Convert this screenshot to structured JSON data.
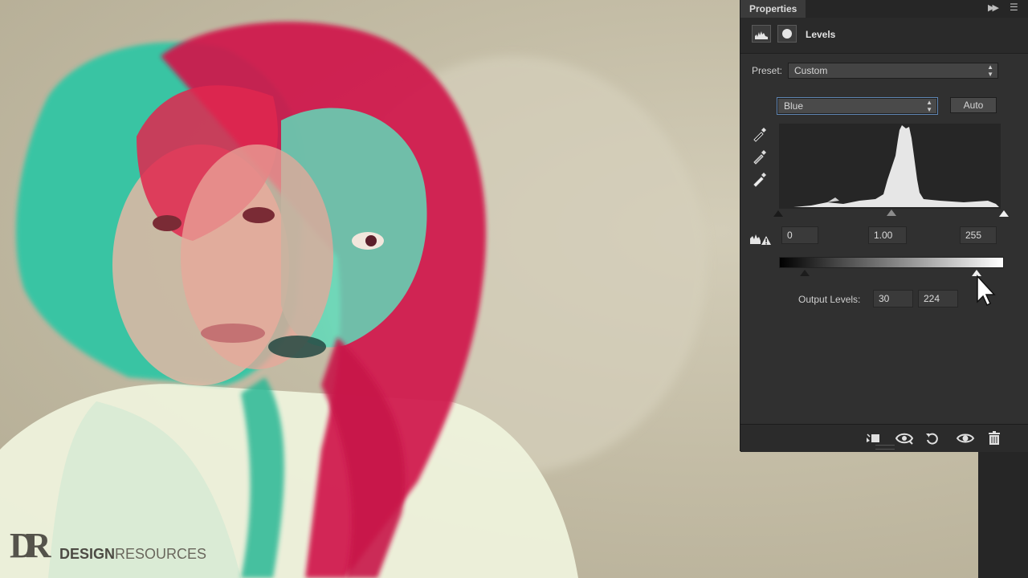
{
  "watermark": {
    "logo": "DR",
    "brand_bold": "DESIGN",
    "brand_light": "RESOURCES"
  },
  "panel": {
    "tab_label": "Properties",
    "layer_title": "Levels",
    "preset_label": "Preset:",
    "preset_value": "Custom",
    "channel_value": "Blue",
    "auto_label": "Auto",
    "input_black": "0",
    "input_gamma": "1.00",
    "input_white": "255",
    "output_label": "Output Levels:",
    "output_black": "30",
    "output_white": "224",
    "icons": {
      "adjustment": "levels-histogram-icon",
      "mask": "mask-icon",
      "eyedroppers": [
        "black-point-eyedropper-icon",
        "gray-point-eyedropper-icon",
        "white-point-eyedropper-icon"
      ],
      "clipping": "clipping-warning-icon",
      "bottom": [
        "clip-to-layer-icon",
        "view-previous-state-icon",
        "reset-icon",
        "visibility-eye-icon",
        "trash-icon"
      ]
    }
  },
  "colors": {
    "panel_bg": "#303030",
    "header_bg": "#262626",
    "cyan_overlay": "#2fc6a4",
    "red_overlay": "#d0184c",
    "canvas_bg": "#c4bda6"
  }
}
